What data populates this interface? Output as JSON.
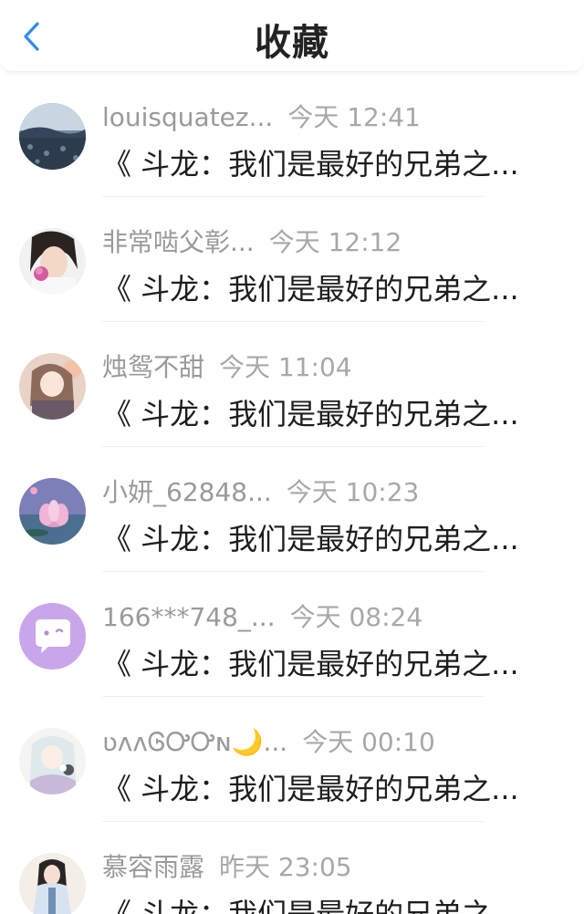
{
  "header": {
    "title": "收藏",
    "back_icon": "chevron-left-icon",
    "accent": "#2f8bf4"
  },
  "items": [
    {
      "name": "louisquatez...",
      "time": "今天 12:41",
      "message": "《 斗龙：我们是最好的兄弟之..."
    },
    {
      "name": "非常啮父彰...",
      "time": "今天 12:12",
      "message": "《 斗龙：我们是最好的兄弟之..."
    },
    {
      "name": "烛鸳不甜",
      "time": "今天 11:04",
      "message": "《 斗龙：我们是最好的兄弟之..."
    },
    {
      "name": "小妍_62848...",
      "time": "今天 10:23",
      "message": "《 斗龙：我们是最好的兄弟之..."
    },
    {
      "name": "166***748_...",
      "time": "今天 08:24",
      "message": "《 斗龙：我们是最好的兄弟之..."
    },
    {
      "name": "ʋʌʌᎶᎤᎤɴ🌙...",
      "time": "今天 00:10",
      "message": "《 斗龙：我们是最好的兄弟之..."
    },
    {
      "name": "慕容雨露",
      "time": "昨天 23:05",
      "message": "《 斗龙：我们是最好的兄弟之..."
    }
  ]
}
